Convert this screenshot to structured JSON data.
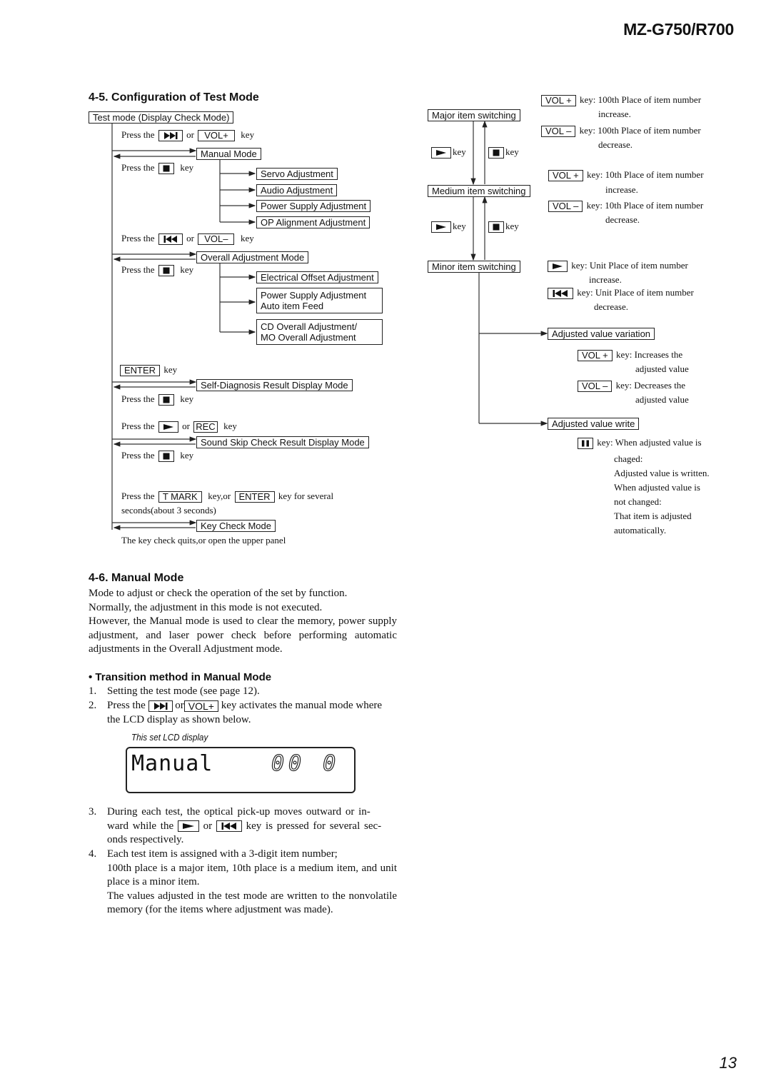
{
  "header": {
    "model": "MZ-G750/R700"
  },
  "page_number": "13",
  "section_4_5": {
    "title": "4-5. Configuration of Test Mode",
    "left": {
      "root_box": "Test mode (Display Check Mode)",
      "press_the": "Press the",
      "or": "or",
      "key": "key",
      "manual": {
        "instruction_keys": [
          "next-track-icon",
          "VOL+"
        ],
        "box": "Manual Mode",
        "return_key": "stop-icon",
        "children": [
          "Servo Adjustment",
          "Audio Adjustment",
          "Power Supply Adjustment",
          "OP Alignment Adjustment"
        ]
      },
      "overall": {
        "instruction_keys": [
          "prev-track-icon",
          "VOL–"
        ],
        "box": "Overall Adjustment Mode",
        "return_key": "stop-icon",
        "children": [
          [
            "Electrical Offset Adjustment"
          ],
          [
            "Power Supply Adjustment",
            "Auto item Feed"
          ],
          [
            "CD Overall Adjustment/",
            "MO Overall Adjustment"
          ]
        ]
      },
      "self_diag": {
        "enter_key": "ENTER",
        "box": "Self-Diagnosis Result Display Mode",
        "return_key": "stop-icon"
      },
      "sound_skip": {
        "instruction_keys": [
          "play-icon",
          "REC"
        ],
        "box": "Sound Skip Check Result Display Mode",
        "return_key": "stop-icon"
      },
      "key_check": {
        "tmark_key": "T MARK",
        "key_or": "key,or",
        "enter_key": "ENTER",
        "tail": "key for several",
        "line2": "seconds(about 3 seconds)",
        "box": "Key Check Mode",
        "quit_note": "The key check quits,or open the upper panel"
      }
    },
    "right": {
      "major": "Major item switching",
      "medium": "Medium item switching",
      "minor": "Minor item switching",
      "down_key_label": "key",
      "up_key_label": "key",
      "notes_major": [
        {
          "key": "VOL +",
          "line1": "key: 100th Place of item number",
          "line2": "increase."
        },
        {
          "key": "VOL –",
          "line1": "key: 100th Place of item number",
          "line2": "decrease."
        }
      ],
      "notes_medium": [
        {
          "key": "VOL +",
          "line1": "key: 10th Place of item number",
          "line2": "increase."
        },
        {
          "key": "VOL –",
          "line1": "key: 10th Place of item number",
          "line2": "decrease."
        }
      ],
      "notes_minor": [
        {
          "key": "play-icon",
          "line1": "key: Unit Place of item number",
          "line2": "increase."
        },
        {
          "key": "prev-track-icon",
          "line1": "key: Unit Place of item number",
          "line2": "decrease."
        }
      ],
      "adjusted_variation": "Adjusted value variation",
      "notes_variation": [
        {
          "key": "VOL +",
          "line1": "key: Increases the",
          "line2": "adjusted value"
        },
        {
          "key": "VOL –",
          "line1": "key: Decreases the",
          "line2": "adjusted value"
        }
      ],
      "adjusted_write": "Adjusted value write",
      "write_note": {
        "key": "pause-icon",
        "line1": "key: When adjusted value is",
        "lines": [
          "chaged:",
          "Adjusted value is written.",
          "When adjusted value is",
          "not changed:",
          "That item is adjusted",
          "automatically."
        ]
      }
    }
  },
  "section_4_6": {
    "title": "4-6. Manual Mode",
    "paragraph": [
      "Mode to adjust or check the operation of the set by function.",
      "Normally, the adjustment in this mode is not executed.",
      "However, the Manual mode is used to clear the memory, power supply adjustment, and laser power check before performing automatic adjustments in the Overall Adjustment mode."
    ],
    "bullet_heading": "Transition method in Manual Mode",
    "steps": [
      {
        "num": "1.",
        "text": "Setting the test mode (see page 12)."
      },
      {
        "num": "2.",
        "pre": "Press the",
        "keys": [
          "next-track-icon",
          "VOL+"
        ],
        "or": "or",
        "post": "key activates the manual mode where",
        "line2": "the LCD display as shown below."
      },
      {
        "num": "3.",
        "pre": "During each test, the optical pick-up moves outward or in-",
        "line2_pre": "ward while the",
        "keys": [
          "play-icon",
          "prev-track-icon"
        ],
        "or": "or",
        "line2_post": "key is pressed for several sec-",
        "line3": "onds respectively."
      },
      {
        "num": "4.",
        "lines": [
          "Each test item is assigned with a 3-digit item number;",
          "100th place is a major item, 10th place is a medium item, and unit place is a minor item.",
          "The values adjusted in the test mode are written to the nonvolatile memory (for the items where adjustment was made)."
        ]
      }
    ],
    "lcd_caption": "This set LCD display",
    "lcd_text": "Manual",
    "lcd_digits": "00 0"
  }
}
